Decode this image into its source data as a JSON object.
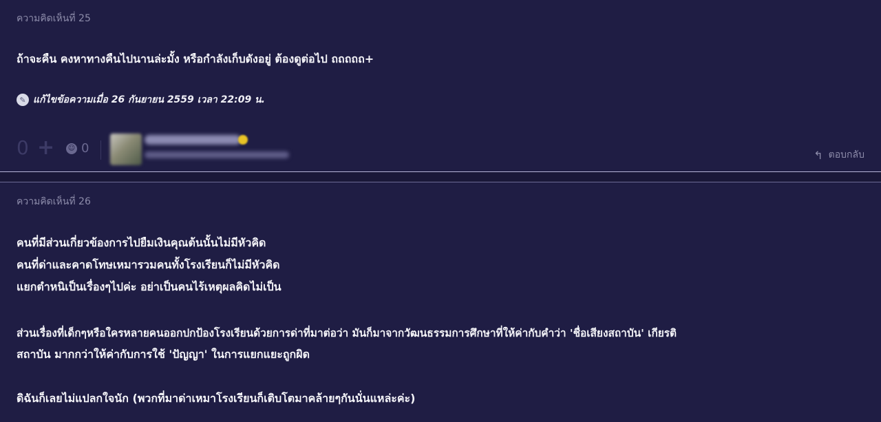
{
  "comments": [
    {
      "label": "ความคิดเห็นที่ 25",
      "body_lines": [
        "ถ้าจะคืน คงหาทางคืนไปนานล่ะมั้ง หรือกำลังเก็บดังอยู่ ต้องดูต่อไป ถถถถถ+"
      ],
      "edit_note": "แก้ไขข้อความเมื่อ 26 กันยายน 2559 เวลา 22:09 น.",
      "votes": "0",
      "emotions": "0",
      "reply_label": "ตอบกลับ"
    },
    {
      "label": "ความคิดเห็นที่ 26",
      "body_lines": [
        "คนที่มีส่วนเกี่ยวข้องการไปยืมเงินคุณต้นนั้นไม่มีหัวคิด",
        "คนที่ด่าและคาดโทษเหมารวมคนทั้งโรงเรียนก็ไม่มีหัวคิด",
        "แยกตำหนิเป็นเรื่องๆไปค่ะ อย่าเป็นคนไร้เหตุผลคิดไม่เป็น",
        "ส่วนเรื่องที่เด็กๆหรือใครหลายคนออกปกป้องโรงเรียนด้วยการด่าที่มาต่อว่า มันก็มาจากวัฒนธรรมการศึกษาที่ให้ค่ากับคำว่า 'ชื่อเสียงสถาบัน' เกียรติ",
        "สถาบัน มากกว่าให้ค่ากับการใช้ 'ปัญญา' ในการแยกแยะถูกผิด",
        "ดิฉันก็เลยไม่แปลกใจนัก (พวกที่มาด่าเหมาโรงเรียนก็เติบโตมาคล้ายๆกันนั่นแหล่ะค่ะ)"
      ]
    }
  ],
  "colors": {
    "background": "#1f1d44",
    "muted_text": "#8d8caa",
    "body_text": "#f4f4f8",
    "badge": "#e8c326"
  },
  "icons": {
    "edit": "edit-icon",
    "plus": "plus-icon",
    "emotion": "emotion-icon",
    "reply": "reply-icon"
  }
}
